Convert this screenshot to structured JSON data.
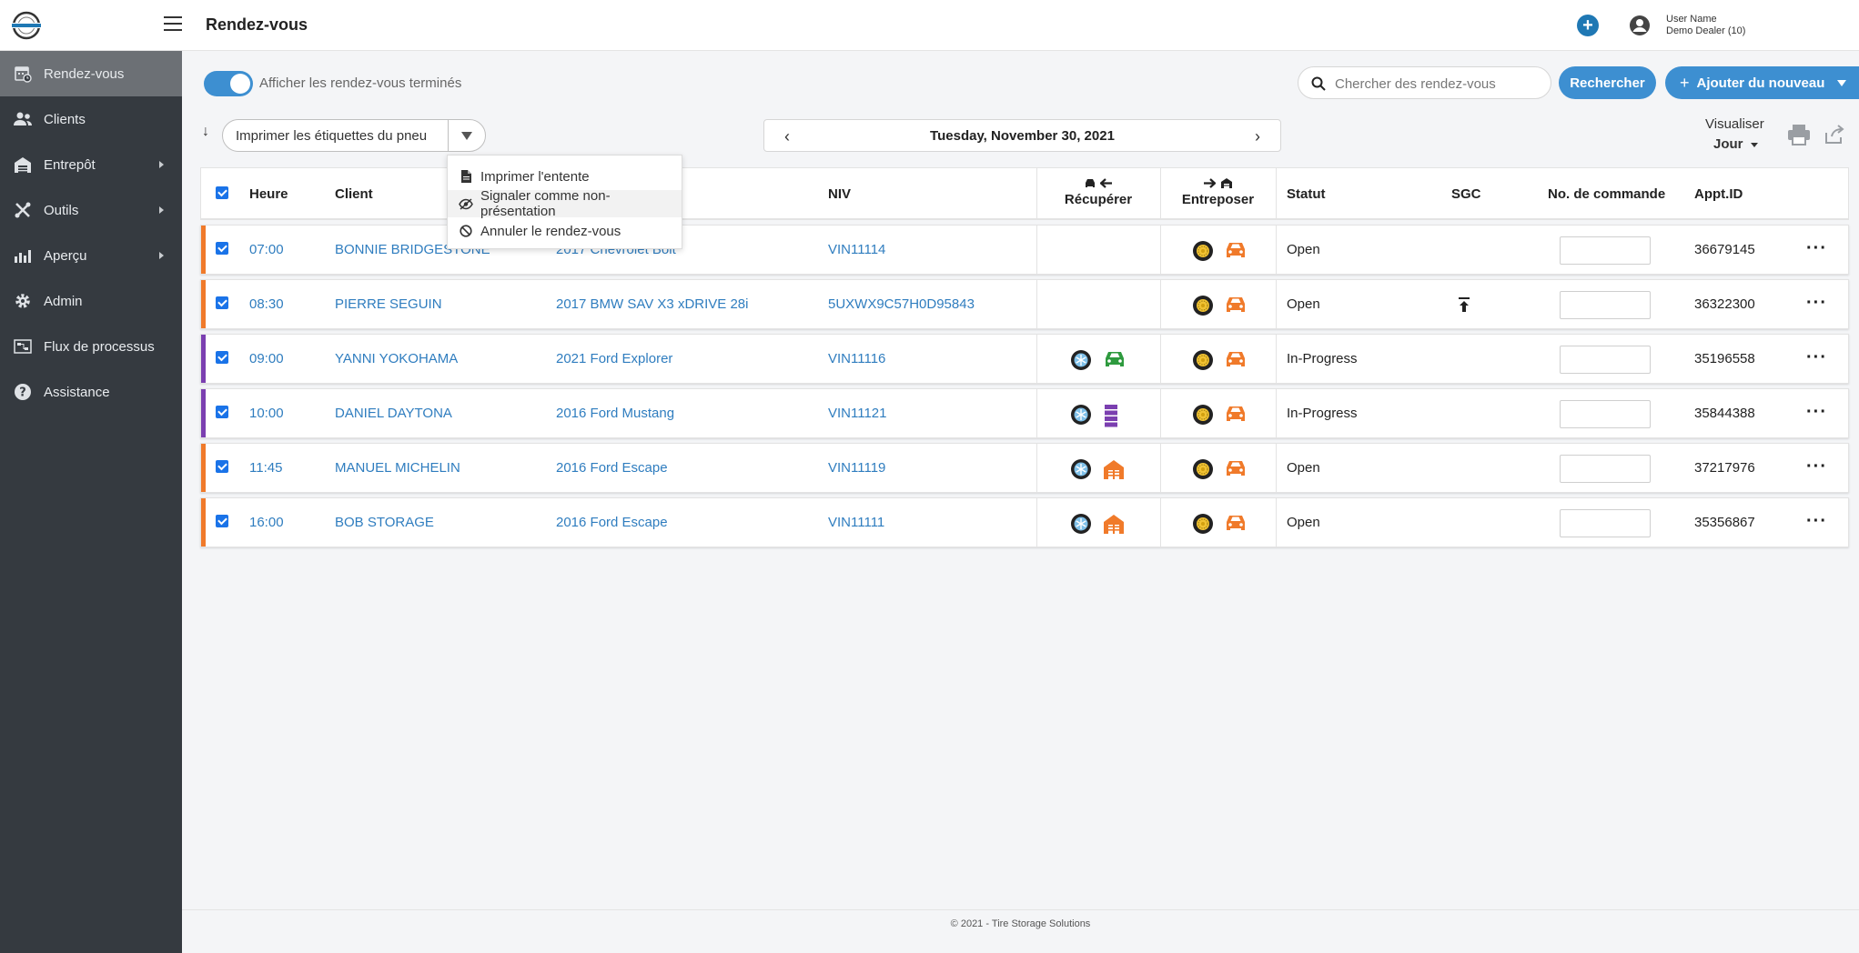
{
  "header": {
    "title": "Rendez-vous",
    "user_name": "User Name",
    "dealer": "Demo Dealer (10)"
  },
  "sidebar": {
    "items": [
      {
        "label": "Rendez-vous",
        "icon": "calendar-icon",
        "active": true
      },
      {
        "label": "Clients",
        "icon": "users-icon"
      },
      {
        "label": "Entrepôt",
        "icon": "warehouse-icon",
        "submenu": true
      },
      {
        "label": "Outils",
        "icon": "tools-icon",
        "submenu": true
      },
      {
        "label": "Aperçu",
        "icon": "chart-icon",
        "submenu": true
      },
      {
        "label": "Admin",
        "icon": "gear-icon"
      },
      {
        "label": "Flux de processus",
        "icon": "workflow-icon"
      },
      {
        "label": "Assistance",
        "icon": "help-icon"
      }
    ]
  },
  "filters": {
    "toggle_label": "Afficher les rendez-vous terminés",
    "search_placeholder": "Chercher des rendez-vous",
    "search_button": "Rechercher",
    "add_button": "Ajouter du nouveau"
  },
  "toolbar": {
    "print_labels": "Imprimer les étiquettes du pneu",
    "date": "Tuesday, November 30, 2021",
    "view_label": "Visualiser",
    "view_value": "Jour"
  },
  "menu": {
    "items": [
      {
        "label": "Imprimer l'entente",
        "icon": "document-icon"
      },
      {
        "label": "Signaler comme non-présentation",
        "icon": "eye-slash-icon"
      },
      {
        "label": "Annuler le rendez-vous",
        "icon": "ban-icon"
      }
    ]
  },
  "table": {
    "headers": {
      "time": "Heure",
      "client": "Client",
      "vin": "NIV",
      "pickup": "Récupérer",
      "store": "Entreposer",
      "status": "Statut",
      "sgc": "SGC",
      "order": "No. de commande",
      "appt": "Appt.ID"
    },
    "rows": [
      {
        "time": "07:00",
        "client": "BONNIE BRIDGESTONE",
        "vehicle": "2017 Chevrolet Bolt",
        "vin": "VIN11114",
        "status": "Open",
        "appt": "36679145",
        "color": "#f07a2a",
        "pickup": [],
        "sgc": false
      },
      {
        "time": "08:30",
        "client": "PIERRE SEGUIN",
        "vehicle": "2017 BMW SAV X3 xDRIVE 28i",
        "vin": "5UXWX9C57H0D95843",
        "status": "Open",
        "appt": "36322300",
        "color": "#f07a2a",
        "pickup": [],
        "sgc": true
      },
      {
        "time": "09:00",
        "client": "YANNI YOKOHAMA",
        "vehicle": "2021 Ford Explorer",
        "vin": "VIN11116",
        "status": "In-Progress",
        "appt": "35196558",
        "color": "#7b3fb0",
        "pickup": [
          "snow-tire-icon",
          "car-green-icon"
        ],
        "sgc": false
      },
      {
        "time": "10:00",
        "client": "DANIEL DAYTONA",
        "vehicle": "2016 Ford Mustang",
        "vin": "VIN11121",
        "status": "In-Progress",
        "appt": "35844388",
        "color": "#7b3fb0",
        "pickup": [
          "snow-tire-icon",
          "rack-purple-icon"
        ],
        "sgc": false
      },
      {
        "time": "11:45",
        "client": "MANUEL MICHELIN",
        "vehicle": "2016 Ford Escape",
        "vin": "VIN11119",
        "status": "Open",
        "appt": "37217976",
        "color": "#f07a2a",
        "pickup": [
          "snow-tire-icon",
          "warehouse-orange-icon"
        ],
        "sgc": false
      },
      {
        "time": "16:00",
        "client": "BOB STORAGE",
        "vehicle": "2016 Ford Escape",
        "vin": "VIN11111",
        "status": "Open",
        "appt": "35356867",
        "color": "#f07a2a",
        "pickup": [
          "snow-tire-icon",
          "warehouse-orange-icon"
        ],
        "sgc": false
      }
    ]
  },
  "footer": {
    "text": "© 2021 - Tire Storage Solutions"
  },
  "colors": {
    "accent": "#3d8fd1",
    "sidebar": "#353a40",
    "open_bar": "#f07a2a",
    "progress_bar": "#7b3fb0",
    "link": "#2f7dbf"
  }
}
